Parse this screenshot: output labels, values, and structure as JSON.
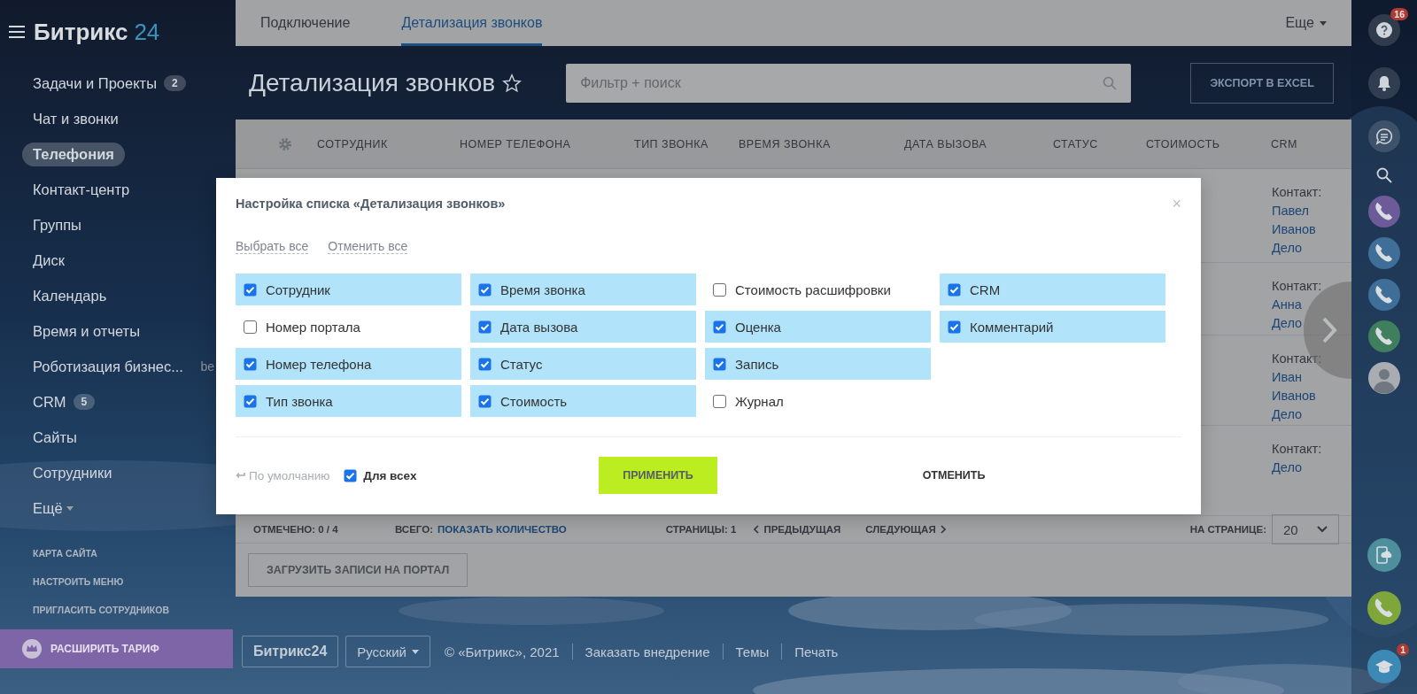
{
  "sidebar": {
    "logo_text": "Битрикс",
    "logo_number": "24",
    "menu": [
      {
        "label": "Задачи и Проекты",
        "counter": "2",
        "selected": false
      },
      {
        "label": "Чат и звонки",
        "selected": false
      },
      {
        "label": "Телефония",
        "selected": true
      },
      {
        "label": "Контакт-центр",
        "selected": false
      },
      {
        "label": "Группы",
        "selected": false
      },
      {
        "label": "Диск",
        "selected": false
      },
      {
        "label": "Календарь",
        "selected": false
      },
      {
        "label": "Время и отчеты",
        "selected": false
      },
      {
        "label": "Роботизация бизнес...",
        "overflow_fragment": "be",
        "selected": false
      },
      {
        "label": "CRM",
        "counter": "5",
        "selected": false
      },
      {
        "label": "Сайты",
        "selected": false
      },
      {
        "label": "Сотрудники",
        "selected": false
      },
      {
        "label": "Ещё",
        "dropdown": true,
        "selected": false
      }
    ],
    "footer_links": [
      "КАРТА САЙТА",
      "НАСТРОИТЬ МЕНЮ",
      "ПРИГЛАСИТЬ СОТРУДНИКОВ"
    ],
    "upgrade_button": "РАСШИРИТЬ ТАРИФ"
  },
  "tabs": [
    {
      "label": "Подключение",
      "selected": false
    },
    {
      "label": "Детализация звонков",
      "selected": true
    }
  ],
  "more_menu": "Еще",
  "page_title": "Детализация звонков",
  "search": {
    "placeholder": "Фильтр + поиск"
  },
  "export_button": "ЭКСПОРТ В EXCEL",
  "table": {
    "columns": [
      "СОТРУДНИК",
      "НОМЕР ТЕЛЕФОНА",
      "ТИП ЗВОНКА",
      "ВРЕМЯ ЗВОНКА",
      "ДАТА ВЫЗОВА",
      "СТАТУС",
      "СТОИМОСТЬ",
      "CRM"
    ],
    "rows": [
      {
        "crm_label": "Контакт:",
        "crm_links": [
          "Павел Иванов",
          "Дело"
        ]
      },
      {
        "crm_label": "Контакт:",
        "crm_links": [
          "Анна",
          "Дело"
        ]
      },
      {
        "crm_label": "Контакт:",
        "crm_links": [
          "Иван Иванов",
          "Дело"
        ]
      },
      {
        "crm_label": "Контакт:",
        "crm_links": [
          "Дело"
        ]
      }
    ]
  },
  "pager": {
    "checked_label": "ОТМЕЧЕНО:",
    "checked_value": "0 / 4",
    "total_label": "ВСЕГО:",
    "total_link": "ПОКАЗАТЬ КОЛИЧЕСТВО",
    "pages_label": "СТРАНИЦЫ:",
    "page": "1",
    "prev": "ПРЕДЫДУЩАЯ",
    "next": "СЛЕДУЮЩАЯ",
    "per_page_label": "НА СТРАНИЦЕ:",
    "per_page": "20"
  },
  "upload_button": "ЗАГРУЗИТЬ ЗАПИСИ НА ПОРТАЛ",
  "footer": {
    "logo": "Битрикс24",
    "language": "Русский",
    "copyright": "© «Битрикс», 2021",
    "links": [
      "Заказать внедрение",
      "Темы",
      "Печать"
    ]
  },
  "right_bar": {
    "help_badge": "16",
    "calls": [
      {
        "color": "#6d5a99"
      },
      {
        "color": "#3f6f99"
      },
      {
        "color": "#3f6f99"
      },
      {
        "color": "#3f7f5e"
      }
    ],
    "learning_badge": "1"
  },
  "dialog": {
    "title": "Настройка списка «Детализация звонков»",
    "close": "×",
    "select_all": "Выбрать все",
    "deselect_all": "Отменить все",
    "options": [
      {
        "label": "Сотрудник",
        "checked": true
      },
      {
        "label": "Номер портала",
        "checked": false
      },
      {
        "label": "Номер телефона",
        "checked": true
      },
      {
        "label": "Тип звонка",
        "checked": true
      },
      {
        "label": "Время звонка",
        "checked": true
      },
      {
        "label": "Дата вызова",
        "checked": true
      },
      {
        "label": "Статус",
        "checked": true
      },
      {
        "label": "Стоимость",
        "checked": true
      },
      {
        "label": "Стоимость расшифровки",
        "checked": false
      },
      {
        "label": "Оценка",
        "checked": true
      },
      {
        "label": "Запись",
        "checked": true
      },
      {
        "label": "Журнал",
        "checked": false
      },
      {
        "label": "CRM",
        "checked": true
      },
      {
        "label": "Комментарий",
        "checked": true
      }
    ],
    "reset": "По умолчанию",
    "for_all": {
      "label": "Для всех",
      "checked": true
    },
    "apply": "ПРИМЕНИТЬ",
    "cancel": "ОТМЕНИТЬ"
  }
}
